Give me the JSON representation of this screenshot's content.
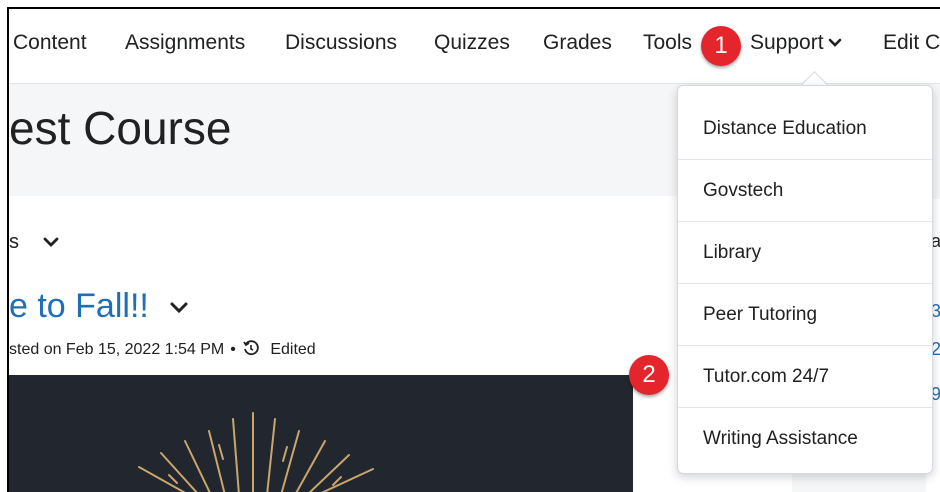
{
  "nav": {
    "items": [
      "Content",
      "Assignments",
      "Discussions",
      "Quizzes",
      "Grades",
      "Tools"
    ],
    "support_label": "Support",
    "edit_label": "Edit C"
  },
  "course": {
    "title": "est Course"
  },
  "announcements": {
    "filter_label": "s",
    "title": "e to Fall!!",
    "posted": "sted on Feb 15, 2022 1:54 PM",
    "edited_label": "Edited"
  },
  "sidebar": {
    "letters": [
      "a",
      "3",
      "2",
      "9"
    ]
  },
  "support_menu": {
    "items": [
      "Distance Education",
      "Govstech",
      "Library",
      "Peer Tutoring",
      "Tutor.com 24/7",
      "Writing Assistance"
    ]
  },
  "callouts": {
    "one": "1",
    "two": "2"
  },
  "colors": {
    "accent": "#1e6fb5",
    "badge": "#e4252b",
    "image_bg": "#22262e"
  }
}
